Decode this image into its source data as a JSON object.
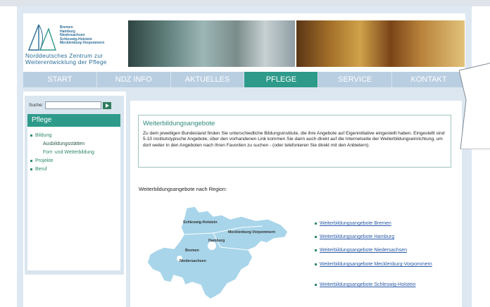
{
  "header": {
    "logo_states": [
      "Bremen",
      "Hamburg",
      "Niedersachsen",
      "Schleswig-Holstein",
      "Mecklenburg-Vorpommern"
    ],
    "logo_title_line1": "Norddeutsches Zentrum zur",
    "logo_title_line2": "Weiterentwicklung der Pflege"
  },
  "nav": {
    "items": [
      {
        "label": "START"
      },
      {
        "label": "NDZ INFO"
      },
      {
        "label": "AKTUELLES"
      },
      {
        "label": "PFLEGE"
      },
      {
        "label": "SERVICE"
      },
      {
        "label": "KONTAKT"
      }
    ],
    "active_index": 3
  },
  "search": {
    "label": "Suche:"
  },
  "sidebar": {
    "heading": "Pflege",
    "items": [
      {
        "label": "Bildung"
      },
      {
        "label": "Ausbildungsstätten"
      },
      {
        "label": "Fort- und Weiterbildung"
      },
      {
        "label": "Projekte"
      },
      {
        "label": "Beruf"
      }
    ]
  },
  "main": {
    "title": "Weiterbildungsangebote",
    "text": "Zu dem jeweiligen Bundesland finden Sie unterschiedliche Bildungsinstitute, die ihre Angebote auf Eigeninitiative eingestellt haben. Eingestellt sind 5-10 institutstypische Angebote, über den vorhandenen Link kommen Sie dann auch direkt auf die Internetseite der Weiterbildungseinrichtung, um dort weiter in den Angeboten nach Ihren Favoriten zu suchen - (oder telefonieren Sie direkt mit den Anbietern).",
    "region_heading": "Weiterbildungsangebote nach Region:",
    "map_labels": {
      "schleswig": "Schleswig-Holstein",
      "mecklenburg": "Mecklenburg-Vorpommern",
      "hamburg": "Hamburg",
      "bremen": "Bremen",
      "niedersachsen": "Niedersachsen"
    },
    "links": [
      {
        "label": "Weiterbildungsangebote Bremen"
      },
      {
        "label": "Weiterbildungsangebote Hamburg"
      },
      {
        "label": "Weiterbildungsangebote Niedersachsen"
      },
      {
        "label": "Weiterbildungsangebote Mecklenburg-Vorpommern"
      },
      {
        "label": "Weiterbildungsangebote Schleswig-Holstein"
      }
    ]
  },
  "colors": {
    "accent_green": "#2e9a8a",
    "nav_blue": "#b9cee1",
    "link_blue": "#2a5ba8",
    "map_blue": "#a8d5ea"
  }
}
